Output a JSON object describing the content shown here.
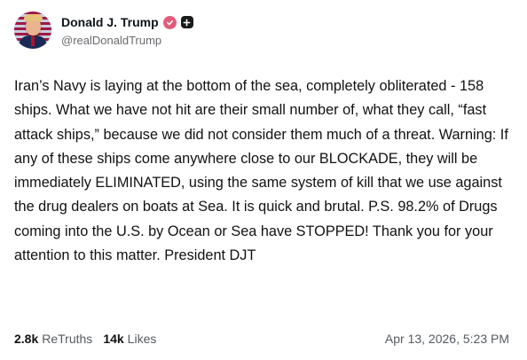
{
  "author": {
    "display_name": "Donald J. Trump",
    "handle": "@realDonaldTrump",
    "verified_color": "#e35b7b"
  },
  "post": {
    "text": "Iran’s Navy is laying at the bottom of the sea, completely obliterated - 158 ships. What we have not hit are their small number of, what they call, “fast attack ships,” because we did not consider them much of a threat. Warning: If any of these ships come anywhere close to our BLOCKADE, they will be immediately ELIMINATED, using the same system of kill that we use against the drug dealers on boats at Sea. It is quick and brutal. P.S. 98.2% of Drugs coming into the U.S. by Ocean or Sea have STOPPED! Thank you for your attention to this matter. President DJT"
  },
  "stats": {
    "retruths_count": "2.8k",
    "retruths_label": "ReTruths",
    "likes_count": "14k",
    "likes_label": "Likes"
  },
  "timestamp": "Apr 13, 2026, 5:23 PM",
  "icons": {
    "verified": "verified-badge-icon",
    "plus": "plus-badge-icon"
  }
}
